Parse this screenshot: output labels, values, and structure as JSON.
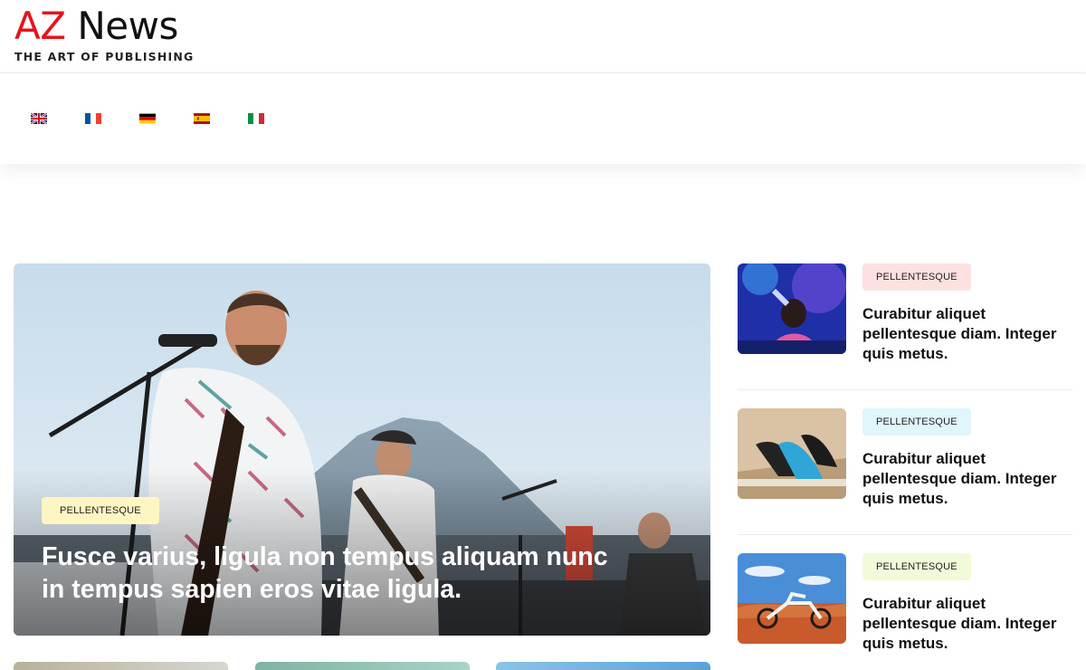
{
  "brand": {
    "logo_az": "AZ",
    "logo_news": "News",
    "tagline": "THE ART OF PUBLISHING",
    "accent_color": "#e5141c"
  },
  "languages": [
    {
      "code": "en",
      "icon": "uk-flag-icon"
    },
    {
      "code": "fr",
      "icon": "france-flag-icon"
    },
    {
      "code": "de",
      "icon": "germany-flag-icon"
    },
    {
      "code": "es",
      "icon": "spain-flag-icon"
    },
    {
      "code": "it",
      "icon": "italy-flag-icon"
    }
  ],
  "featured": {
    "category": "PELLENTESQUE",
    "category_color": "#fef6c2",
    "title": "Fusce varius, ligula non tempus aliquam nunc in tempus sapien eros vitae ligula."
  },
  "side_posts": [
    {
      "category": "PELLENTESQUE",
      "category_color": "#fde1e1",
      "title": "Curabitur aliquet pellentesque diam. Integer quis metus."
    },
    {
      "category": "PELLENTESQUE",
      "category_color": "#dff6fb",
      "title": "Curabitur aliquet pellentesque diam. Integer quis metus."
    },
    {
      "category": "PELLENTESQUE",
      "category_color": "#f1fbd9",
      "title": "Curabitur aliquet pellentesque diam. Integer quis metus."
    }
  ]
}
